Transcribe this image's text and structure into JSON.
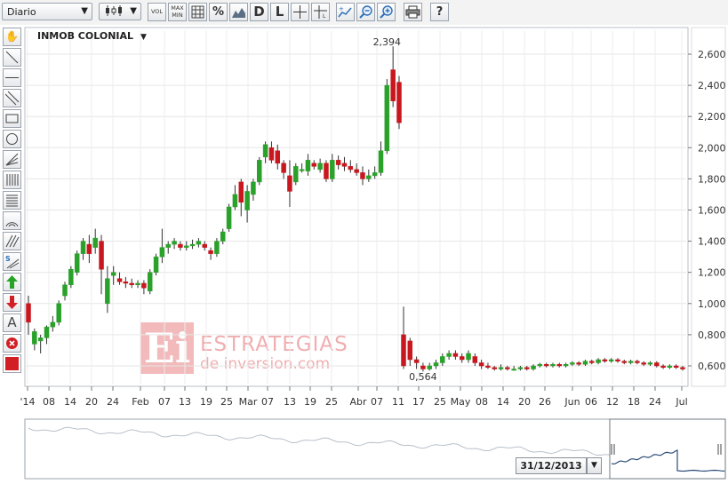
{
  "toolbar": {
    "period_select": "Diario",
    "buttons": [
      {
        "name": "candle-type-button",
        "icon": "candlestick-icon",
        "label": ""
      },
      {
        "name": "vol-button",
        "icon": "",
        "label": "VOL"
      },
      {
        "name": "maxmin-button",
        "icon": "",
        "label": "MAX MIN"
      },
      {
        "name": "grid-button",
        "icon": "grid-icon",
        "label": ""
      },
      {
        "name": "percent-button",
        "icon": "",
        "label": "%"
      },
      {
        "name": "mountain-button",
        "icon": "mountain-chart-icon",
        "label": ""
      },
      {
        "name": "d-button",
        "icon": "",
        "label": "D"
      },
      {
        "name": "l-button",
        "icon": "",
        "label": "L"
      },
      {
        "name": "crosshair-button",
        "icon": "crosshair-icon",
        "label": ""
      },
      {
        "name": "crosshair-label-button",
        "icon": "crosshair-label-icon",
        "label": ""
      },
      {
        "name": "compare-button",
        "icon": "compare-icon",
        "label": ""
      },
      {
        "name": "zoom-out-button",
        "icon": "zoom-out-icon",
        "label": ""
      },
      {
        "name": "zoom-in-button",
        "icon": "zoom-in-icon",
        "label": ""
      },
      {
        "name": "print-button",
        "icon": "printer-icon",
        "label": ""
      },
      {
        "name": "help-button",
        "icon": "help-icon",
        "label": "?"
      }
    ]
  },
  "left_tools": [
    {
      "name": "hand-tool",
      "icon": "hand-icon"
    },
    {
      "name": "trendline-tool",
      "icon": "diagonal-line-icon"
    },
    {
      "name": "horizontal-line-tool",
      "icon": "horizontal-line-icon"
    },
    {
      "name": "channel-tool",
      "icon": "parallel-lines-icon"
    },
    {
      "name": "rectangle-tool",
      "icon": "rectangle-icon"
    },
    {
      "name": "ellipse-tool",
      "icon": "circle-icon"
    },
    {
      "name": "fan-tool",
      "icon": "fan-icon"
    },
    {
      "name": "fibonacci-vertical-tool",
      "icon": "vertical-lines-icon"
    },
    {
      "name": "fibonacci-tool",
      "icon": "horizontal-lines-icon"
    },
    {
      "name": "arc-tool",
      "icon": "arc-icon"
    },
    {
      "name": "hatched-channel-tool",
      "icon": "hatch-icon"
    },
    {
      "name": "speed-lines-tool",
      "icon": "speed-lines-icon"
    },
    {
      "name": "buy-signal-tool",
      "icon": "green-up-arrow-icon"
    },
    {
      "name": "sell-signal-tool",
      "icon": "red-down-arrow-icon"
    },
    {
      "name": "text-tool",
      "icon": "letter-a-icon"
    },
    {
      "name": "delete-tool",
      "icon": "red-x-icon"
    },
    {
      "name": "color-tool",
      "icon": "red-swatch-icon"
    }
  ],
  "watermark": {
    "logo": "Ei",
    "line1": "ESTRATEGIAS",
    "line2": "de inversion.com"
  },
  "navigator": {
    "date": "31/12/2013"
  },
  "colors": {
    "up": "#2aa12a",
    "down": "#c8171e",
    "grid": "#e4e4e4",
    "navigator_line": "#9aa3ad",
    "navigator_focus": "#2c4d77"
  },
  "chart_data": {
    "type": "candlestick",
    "title": "INMOB COLONIAL",
    "ylim": [
      0.45,
      2.7
    ],
    "y_ticks": [
      "2,600",
      "2,400",
      "2,200",
      "2,000",
      "1,800",
      "1,600",
      "1,400",
      "1,200",
      "1,000",
      "0,800",
      "0,600"
    ],
    "x_ticks": [
      "'14",
      "08",
      "14",
      "20",
      "24",
      "Feb",
      "07",
      "13",
      "19",
      "25",
      "Mar",
      "07",
      "13",
      "19",
      "25",
      "Abr",
      "07",
      "11",
      "17",
      "25",
      "May",
      "08",
      "14",
      "20",
      "26",
      "Jun",
      "06",
      "12",
      "18",
      "24",
      "Jul"
    ],
    "annotations": [
      {
        "text": "2,394",
        "at": "max",
        "value": 2.394
      },
      {
        "text": "0,564",
        "at": "min",
        "value": 0.564
      }
    ],
    "candles": [
      [
        1.0,
        0.88,
        1.05,
        0.8
      ],
      [
        0.74,
        0.82,
        0.84,
        0.7
      ],
      [
        0.76,
        0.78,
        0.8,
        0.68
      ],
      [
        0.78,
        0.85,
        0.86,
        0.74
      ],
      [
        0.85,
        0.88,
        0.92,
        0.82
      ],
      [
        0.88,
        1.0,
        1.02,
        0.86
      ],
      [
        1.05,
        1.12,
        1.14,
        1.02
      ],
      [
        1.12,
        1.22,
        1.24,
        1.1
      ],
      [
        1.2,
        1.32,
        1.34,
        1.18
      ],
      [
        1.32,
        1.4,
        1.42,
        1.28
      ],
      [
        1.38,
        1.32,
        1.44,
        1.26
      ],
      [
        1.36,
        1.42,
        1.48,
        1.32
      ],
      [
        1.4,
        1.22,
        1.44,
        1.06
      ],
      [
        1.0,
        1.16,
        1.24,
        0.94
      ],
      [
        1.18,
        1.2,
        1.24,
        1.12
      ],
      [
        1.16,
        1.14,
        1.2,
        1.12
      ],
      [
        1.14,
        1.13,
        1.17,
        1.1
      ],
      [
        1.13,
        1.12,
        1.16,
        1.1
      ],
      [
        1.12,
        1.13,
        1.15,
        1.1
      ],
      [
        1.13,
        1.1,
        1.15,
        1.06
      ],
      [
        1.08,
        1.2,
        1.22,
        1.06
      ],
      [
        1.2,
        1.3,
        1.32,
        1.18
      ],
      [
        1.3,
        1.36,
        1.48,
        1.26
      ],
      [
        1.36,
        1.38,
        1.4,
        1.32
      ],
      [
        1.38,
        1.4,
        1.42,
        1.35
      ],
      [
        1.38,
        1.36,
        1.4,
        1.34
      ],
      [
        1.36,
        1.37,
        1.4,
        1.34
      ],
      [
        1.37,
        1.38,
        1.41,
        1.35
      ],
      [
        1.38,
        1.4,
        1.42,
        1.36
      ],
      [
        1.38,
        1.36,
        1.4,
        1.34
      ],
      [
        1.34,
        1.32,
        1.36,
        1.28
      ],
      [
        1.32,
        1.4,
        1.42,
        1.3
      ],
      [
        1.4,
        1.46,
        1.48,
        1.38
      ],
      [
        1.48,
        1.62,
        1.64,
        1.46
      ],
      [
        1.62,
        1.7,
        1.76,
        1.6
      ],
      [
        1.78,
        1.65,
        1.8,
        1.56
      ],
      [
        1.6,
        1.72,
        1.76,
        1.52
      ],
      [
        1.7,
        1.78,
        1.8,
        1.66
      ],
      [
        1.78,
        1.92,
        1.94,
        1.76
      ],
      [
        1.94,
        2.02,
        2.04,
        1.9
      ],
      [
        2.0,
        1.92,
        2.04,
        1.9
      ],
      [
        1.98,
        1.9,
        2.02,
        1.86
      ],
      [
        1.9,
        1.84,
        1.92,
        1.8
      ],
      [
        1.82,
        1.72,
        1.92,
        1.62
      ],
      [
        1.78,
        1.88,
        1.9,
        1.76
      ],
      [
        1.86,
        1.86,
        1.9,
        1.84
      ],
      [
        1.85,
        1.92,
        1.96,
        1.82
      ],
      [
        1.9,
        1.88,
        1.92,
        1.86
      ],
      [
        1.86,
        1.9,
        1.93,
        1.84
      ],
      [
        1.9,
        1.8,
        1.92,
        1.78
      ],
      [
        1.8,
        1.92,
        1.96,
        1.78
      ],
      [
        1.92,
        1.89,
        1.95,
        1.86
      ],
      [
        1.9,
        1.88,
        1.94,
        1.85
      ],
      [
        1.88,
        1.86,
        1.92,
        1.84
      ],
      [
        1.86,
        1.84,
        1.9,
        1.82
      ],
      [
        1.84,
        1.8,
        1.88,
        1.76
      ],
      [
        1.8,
        1.82,
        1.86,
        1.78
      ],
      [
        1.82,
        1.84,
        1.88,
        1.8
      ],
      [
        1.84,
        1.98,
        2.04,
        1.82
      ],
      [
        1.98,
        2.4,
        2.44,
        1.96
      ],
      [
        2.5,
        2.3,
        2.65,
        2.26
      ],
      [
        2.42,
        2.16,
        2.46,
        2.12
      ],
      [
        0.8,
        0.6,
        0.98,
        0.58
      ],
      [
        0.76,
        0.64,
        0.78,
        0.6
      ],
      [
        0.64,
        0.62,
        0.66,
        0.58
      ],
      [
        0.6,
        0.58,
        0.62,
        0.564
      ],
      [
        0.58,
        0.6,
        0.62,
        0.57
      ],
      [
        0.6,
        0.62,
        0.64,
        0.58
      ],
      [
        0.62,
        0.66,
        0.68,
        0.6
      ],
      [
        0.66,
        0.68,
        0.7,
        0.64
      ],
      [
        0.68,
        0.66,
        0.7,
        0.64
      ],
      [
        0.66,
        0.64,
        0.68,
        0.62
      ],
      [
        0.64,
        0.68,
        0.7,
        0.62
      ],
      [
        0.66,
        0.62,
        0.68,
        0.6
      ],
      [
        0.62,
        0.6,
        0.64,
        0.58
      ],
      [
        0.6,
        0.59,
        0.62,
        0.58
      ],
      [
        0.59,
        0.58,
        0.6,
        0.57
      ],
      [
        0.58,
        0.59,
        0.61,
        0.57
      ],
      [
        0.59,
        0.58,
        0.6,
        0.57
      ],
      [
        0.58,
        0.58,
        0.6,
        0.57
      ],
      [
        0.58,
        0.59,
        0.6,
        0.57
      ],
      [
        0.59,
        0.58,
        0.6,
        0.57
      ],
      [
        0.58,
        0.6,
        0.61,
        0.57
      ],
      [
        0.6,
        0.61,
        0.62,
        0.59
      ],
      [
        0.61,
        0.6,
        0.62,
        0.59
      ],
      [
        0.6,
        0.61,
        0.62,
        0.59
      ],
      [
        0.61,
        0.6,
        0.62,
        0.59
      ],
      [
        0.6,
        0.61,
        0.62,
        0.59
      ],
      [
        0.61,
        0.62,
        0.63,
        0.6
      ],
      [
        0.62,
        0.61,
        0.63,
        0.6
      ],
      [
        0.61,
        0.63,
        0.64,
        0.6
      ],
      [
        0.63,
        0.62,
        0.64,
        0.61
      ],
      [
        0.62,
        0.64,
        0.65,
        0.61
      ],
      [
        0.64,
        0.63,
        0.65,
        0.62
      ],
      [
        0.63,
        0.64,
        0.65,
        0.62
      ],
      [
        0.64,
        0.63,
        0.65,
        0.62
      ],
      [
        0.63,
        0.62,
        0.64,
        0.61
      ],
      [
        0.62,
        0.63,
        0.64,
        0.61
      ],
      [
        0.63,
        0.62,
        0.64,
        0.61
      ],
      [
        0.62,
        0.61,
        0.63,
        0.6
      ],
      [
        0.61,
        0.62,
        0.63,
        0.6
      ],
      [
        0.62,
        0.6,
        0.63,
        0.59
      ],
      [
        0.6,
        0.59,
        0.61,
        0.58
      ],
      [
        0.59,
        0.6,
        0.61,
        0.58
      ],
      [
        0.6,
        0.59,
        0.61,
        0.58
      ],
      [
        0.59,
        0.58,
        0.6,
        0.57
      ]
    ]
  }
}
